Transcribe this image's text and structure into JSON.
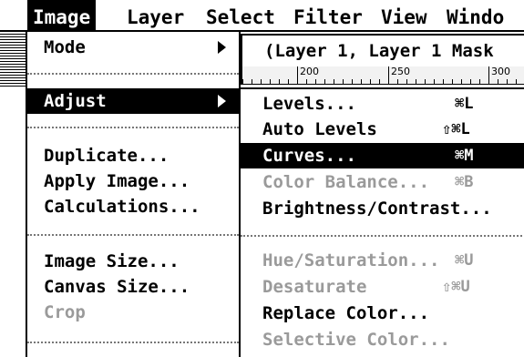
{
  "menubar": {
    "items": [
      "Image",
      "Layer",
      "Select",
      "Filter",
      "View",
      "Windo"
    ]
  },
  "document": {
    "title": "(Layer 1, Layer 1 Mask",
    "ruler_labels": [
      "200",
      "250",
      "300"
    ]
  },
  "image_menu": {
    "mode": "Mode",
    "adjust": "Adjust",
    "duplicate": "Duplicate...",
    "apply_image": "Apply Image...",
    "calculations": "Calculations...",
    "image_size": "Image Size...",
    "canvas_size": "Canvas Size...",
    "crop": "Crop"
  },
  "adjust_menu": {
    "levels": "Levels...",
    "levels_shortcut": "⌘L",
    "auto_levels": "Auto Levels",
    "auto_levels_shortcut": "⇧⌘L",
    "curves": "Curves...",
    "curves_shortcut": "⌘M",
    "color_balance": "Color Balance...",
    "color_balance_shortcut": "⌘B",
    "brightness_contrast": "Brightness/Contrast...",
    "hue_saturation": "Hue/Saturation...",
    "hue_saturation_shortcut": "⌘U",
    "desaturate": "Desaturate",
    "desaturate_shortcut": "⇧⌘U",
    "replace_color": "Replace Color...",
    "selective_color": "Selective Color..."
  },
  "icons": {
    "submenu_arrow": "triangle-right-icon"
  }
}
